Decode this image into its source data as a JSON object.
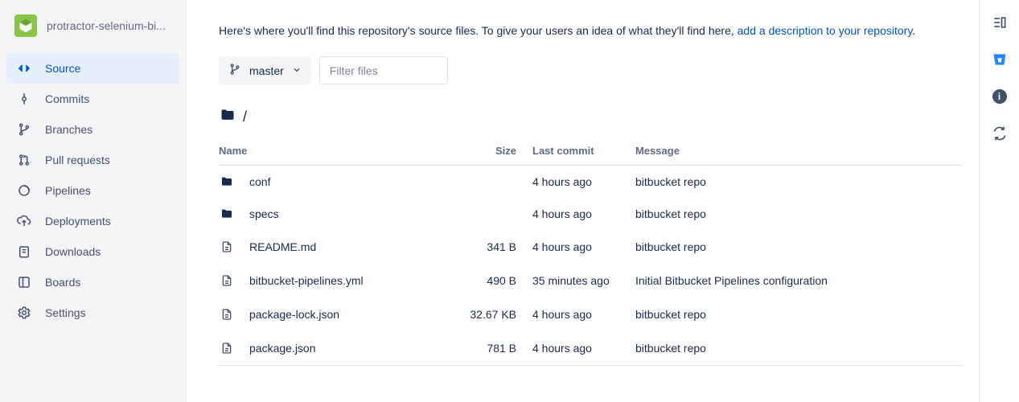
{
  "repo": {
    "name": "protractor-selenium-bi..."
  },
  "nav": {
    "source": "Source",
    "commits": "Commits",
    "branches": "Branches",
    "pull_requests": "Pull requests",
    "pipelines": "Pipelines",
    "deployments": "Deployments",
    "downloads": "Downloads",
    "boards": "Boards",
    "settings": "Settings"
  },
  "intro": {
    "text_before": "Here's where you'll find this repository's source files. To give your users an idea of what they'll find here, ",
    "link": "add a description to your repository",
    "text_after": "."
  },
  "branch": {
    "name": "master"
  },
  "filter": {
    "placeholder": "Filter files"
  },
  "breadcrumb": {
    "root": "/"
  },
  "table": {
    "headers": {
      "name": "Name",
      "size": "Size",
      "last_commit": "Last commit",
      "message": "Message"
    },
    "rows": [
      {
        "type": "folder",
        "name": "conf",
        "size": "",
        "last_commit": "4 hours ago",
        "message": "bitbucket repo"
      },
      {
        "type": "folder",
        "name": "specs",
        "size": "",
        "last_commit": "4 hours ago",
        "message": "bitbucket repo"
      },
      {
        "type": "file",
        "name": "README.md",
        "size": "341 B",
        "last_commit": "4 hours ago",
        "message": "bitbucket repo"
      },
      {
        "type": "file",
        "name": "bitbucket-pipelines.yml",
        "size": "490 B",
        "last_commit": "35 minutes ago",
        "message": "Initial Bitbucket Pipelines configuration"
      },
      {
        "type": "file",
        "name": "package-lock.json",
        "size": "32.67 KB",
        "last_commit": "4 hours ago",
        "message": "bitbucket repo"
      },
      {
        "type": "file",
        "name": "package.json",
        "size": "781 B",
        "last_commit": "4 hours ago",
        "message": "bitbucket repo"
      }
    ]
  }
}
